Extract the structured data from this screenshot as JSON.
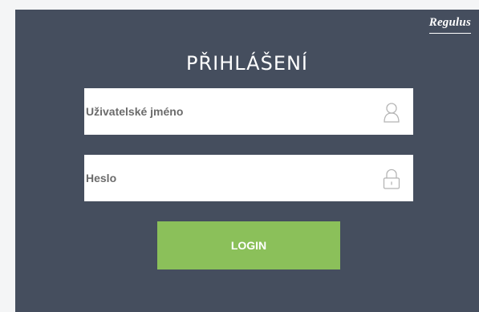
{
  "brand": {
    "logo_text": "Regulus"
  },
  "login": {
    "title": "PŘIHLÁŠENÍ",
    "username": {
      "value": "",
      "placeholder": "Uživatelské jméno",
      "icon": "user-icon"
    },
    "password": {
      "value": "",
      "placeholder": "Heslo",
      "icon": "lock-icon"
    },
    "submit_label": "LOGIN"
  },
  "colors": {
    "panel_background": "#454e5e",
    "page_background": "#f4f5f6",
    "button_background": "#8bc05a",
    "text_on_dark": "#ffffff",
    "icon_stroke": "#b5b5b5"
  }
}
